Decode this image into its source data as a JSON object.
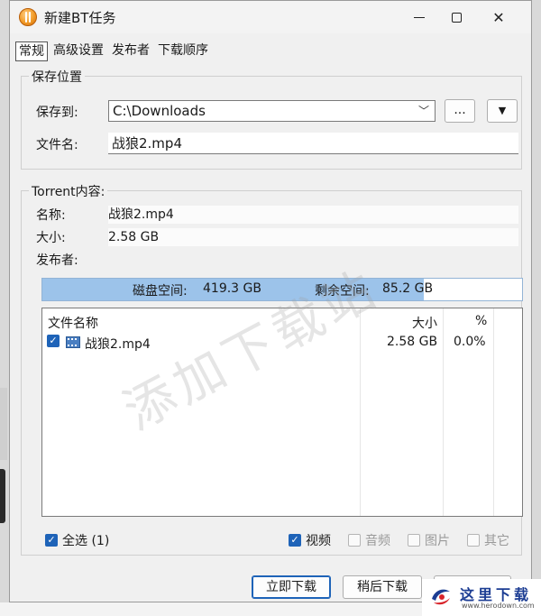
{
  "window": {
    "title": "新建BT任务"
  },
  "tabs": [
    {
      "label": "常规",
      "active": true
    },
    {
      "label": "高级设置",
      "active": false
    },
    {
      "label": "发布者",
      "active": false
    },
    {
      "label": "下载顺序",
      "active": false
    }
  ],
  "save": {
    "group_title": "保存位置",
    "save_to_label": "保存到:",
    "save_to_value": "C:\\Downloads",
    "browse_label": "...",
    "filename_label": "文件名:",
    "filename_value": "战狼2.mp4"
  },
  "torrent": {
    "group_title": "Torrent内容:",
    "name_label": "名称:",
    "name_value": "战狼2.mp4",
    "size_label": "大小:",
    "size_value": "2.58 GB",
    "publisher_label": "发布者:",
    "publisher_value": ""
  },
  "disk": {
    "disk_label": "磁盘空间:",
    "disk_value": "419.3 GB",
    "free_label": "剩余空间:",
    "free_value": "85.2 GB",
    "used_fraction": 0.795
  },
  "filelist": {
    "headers": {
      "name": "文件名称",
      "size": "大小",
      "percent": "%"
    },
    "rows": [
      {
        "checked": true,
        "name": "战狼2.mp4",
        "size": "2.58 GB",
        "percent": "0.0%"
      }
    ]
  },
  "filters": {
    "select_all": "全选 (1)",
    "video": "视频",
    "audio": "音频",
    "image": "图片",
    "other": "其它"
  },
  "buttons": {
    "download_now": "立即下载",
    "download_later": "稍后下载"
  },
  "watermark": "添加下载站",
  "site": {
    "name": "这里下载",
    "url": "www.herodown.com"
  },
  "colors": {
    "accent": "#1e63b8",
    "bar_fill": "#9cc3ea"
  }
}
